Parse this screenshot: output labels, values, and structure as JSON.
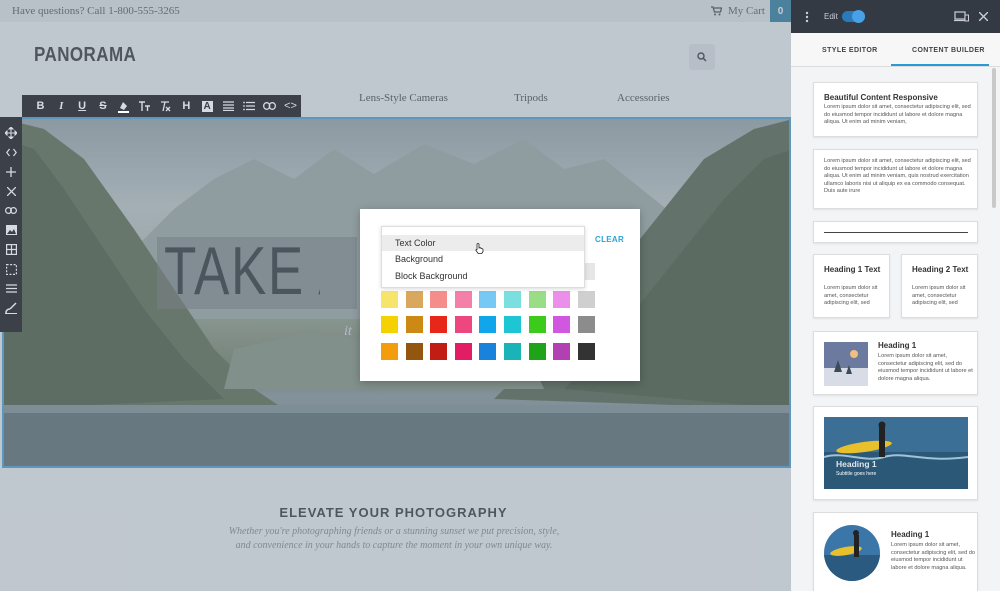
{
  "topbar": {
    "question": "Have questions? Call 1-800-555-3265",
    "cart_label": "My Cart",
    "cart_count": "0"
  },
  "site": {
    "logo": "PANORAMA"
  },
  "nav": {
    "items": [
      "Lens-Style Cameras",
      "Tripods",
      "Accessories"
    ]
  },
  "hero": {
    "title": "TAKE A",
    "subtitle": "it"
  },
  "section": {
    "heading": "ELEVATE YOUR PHOTOGRAPHY",
    "text_line1": "Whether you're photographing friends or a stunning sunset we put precision, style,",
    "text_line2": "and convenience in your hands to capture the moment in your own unique way."
  },
  "format_toolbar": {
    "icons": [
      "bold-icon",
      "italic-icon",
      "underline-icon",
      "strikethrough-icon",
      "text-color-icon",
      "font-size-icon",
      "clear-format-icon",
      "heading-icon",
      "font-icon",
      "align-icon",
      "list-icon",
      "link-icon",
      "code-icon"
    ],
    "labels": {
      "bold": "B",
      "italic": "I",
      "underline": "U",
      "strike": "S",
      "heading": "H",
      "font": "A",
      "code": "<>"
    }
  },
  "side_toolbar": {
    "icons": [
      "move-icon",
      "code-icon",
      "add-icon",
      "delete-icon",
      "link-icon",
      "image-icon",
      "grid-icon",
      "select-icon",
      "menu-icon",
      "brush-icon"
    ]
  },
  "color_picker": {
    "clear_label": "CLEAR",
    "dropdown": {
      "options": [
        "Text Color",
        "Background",
        "Block Background"
      ],
      "highlighted": "Text Color"
    },
    "swatches": [
      [
        "#f8eea3",
        "#e4c38d",
        "#f5aaa8",
        "#f7a9c6",
        "#a7dcf8",
        "#a6ecec",
        "#b9e9a8",
        "#f1b5f0",
        "#e6e6e6"
      ],
      [
        "#f7e46b",
        "#d8a85e",
        "#f58d8d",
        "#f47fa9",
        "#76c8f5",
        "#7bdfe0",
        "#99dd87",
        "#eb8fea",
        "#cfcfcf"
      ],
      [
        "#f6d100",
        "#cc8913",
        "#e8271b",
        "#ee4780",
        "#11a6eb",
        "#1ec6d3",
        "#3ccb1b",
        "#d156e0",
        "#8c8c8c"
      ],
      [
        "#f49d0c",
        "#93560f",
        "#c11d12",
        "#e11e63",
        "#1882dd",
        "#1ab3b8",
        "#1fa319",
        "#b340b3",
        "#333333"
      ]
    ],
    "visible_rows": [
      {
        "start": 8,
        "colors": [
          "#f8eea3"
        ]
      }
    ]
  },
  "panel": {
    "edit_label": "Edit",
    "tabs": [
      "STYLE EDITOR",
      "CONTENT BUILDER"
    ],
    "active_tab": "CONTENT BUILDER",
    "cards": {
      "c1_title": "Beautiful Content Responsive",
      "c1_text": "Lorem ipsum dolor sit amet, consectetur adipiscing elit, sed do eiusmod tempor incididunt ut labore et dolore magna aliqua. Ut enim ad minim veniam,",
      "c2_text": "Lorem ipsum dolor sit amet, consectetur adipiscing elit, sed do eiusmod tempor incididunt ut labore et dolore magna aliqua. Ut enim ad minim veniam, quis nostrud exercitation ullamco laboris nisi ut aliquip ex ea commodo consequat. Duis aute irure",
      "c4a_title": "Heading 1 Text",
      "c4a_text": "Lorem ipsum dolor sit amet, consectetur adipiscing elit, sed",
      "c4b_title": "Heading 2 Text",
      "c4b_text": "Lorem ipsum dolor sit amet, consectetur adipiscing elit, sed",
      "c5_title": "Heading 1",
      "c5_text": "Lorem ipsum dolor sit amet, consectetur adipiscing elit, sed do eiusmod tempor incididunt ut labore et dolore magna aliqua.",
      "c6_title": "Heading 1",
      "c6_sub": "Subtitle goes here",
      "c7_title": "Heading 1",
      "c7_text": "Lorem ipsum dolor sit amet, consectetur adipiscing elit, sed do eiusmod tempor incididunt ut labore et dolore magna aliqua."
    }
  }
}
